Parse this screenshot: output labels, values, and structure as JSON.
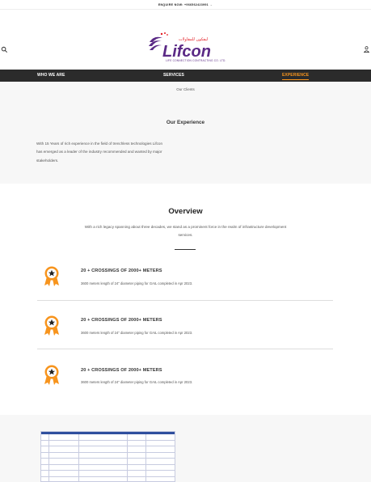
{
  "topbar": {
    "enquiry": "ENQUIRE NOW: +966562423991 →"
  },
  "logo": {
    "brand": "Lifcon",
    "arabic": "ليفكون للمقاولات",
    "tagline": "LIFE CONNECTION CONTRACTING CO. LTD."
  },
  "nav": {
    "items": [
      {
        "label": "WHO WE ARE"
      },
      {
        "label": "SERVICES"
      },
      {
        "label": "EXPERIENCE"
      }
    ],
    "active": "EXPERIENCE"
  },
  "submenu": {
    "label": "Our Clients"
  },
  "experience": {
    "title": "Our Experience",
    "text": "With 15 Years of rich experience in the field of trenchless technologies Lifcon has emerged as a leader of the industry recommended and wanted by major stakeholders."
  },
  "overview": {
    "title": "Overview",
    "text": "With a rich legacy spanning about three decades, we stand as a prominent force in the realm of infrastructure development services."
  },
  "achievements": [
    {
      "title": "20 + CROSSINGS OF 2000+ METERS",
      "desc": "3600 meters length of 24\" diameter piping for GAIL completed in Apr 2023.",
      "icon": "medal-icon"
    },
    {
      "title": "20 + CROSSINGS OF 2000+ METERS",
      "desc": "3600 meters length of 24\" diameter piping for GAIL completed in Apr 2023.",
      "icon": "medal-icon"
    },
    {
      "title": "20 + CROSSINGS OF 2000+ METERS",
      "desc": "3600 meters length of 24\" diameter piping for GAIL completed in Apr 2023.",
      "icon": "medal-icon"
    }
  ],
  "colors": {
    "accent": "#f7941d",
    "nav_bg": "#2b2b2b",
    "brand_purple": "#5b2a86",
    "brand_red": "#e31b23"
  },
  "icons": {
    "search": "search-icon",
    "user": "user-icon"
  }
}
